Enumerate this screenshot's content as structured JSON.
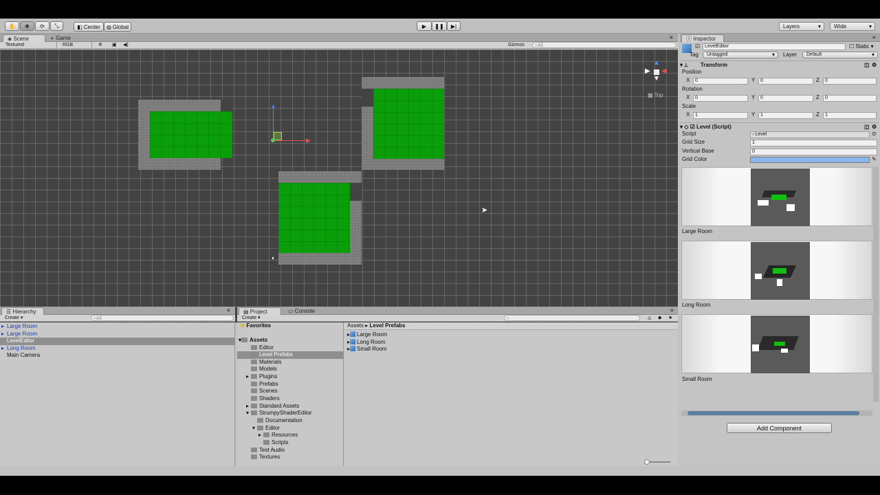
{
  "toolbar": {
    "pivot_label": "Center",
    "handle_label": "Global",
    "layers_label": "Layers",
    "layout_label": "Wide"
  },
  "scene": {
    "tabs": [
      "Scene",
      "Game"
    ],
    "draw_mode": "Textured",
    "color_mode": "RGB",
    "gizmos_label": "Gizmos",
    "search_placeholder": "All",
    "orientation_label": "Top"
  },
  "hierarchy": {
    "tab": "Hierarchy",
    "create_label": "Create",
    "search_placeholder": "All",
    "items": [
      {
        "label": "Large Room",
        "prefab": true,
        "expandable": true,
        "selected": false
      },
      {
        "label": "Large Room",
        "prefab": true,
        "expandable": true,
        "selected": false
      },
      {
        "label": "LevelEditor",
        "prefab": false,
        "expandable": false,
        "selected": true
      },
      {
        "label": "Long Room",
        "prefab": true,
        "expandable": true,
        "selected": false
      },
      {
        "label": "Main Camera",
        "prefab": false,
        "expandable": false,
        "selected": false
      }
    ]
  },
  "project": {
    "tabs": [
      "Project",
      "Console"
    ],
    "create_label": "Create",
    "favorites_label": "Favorites",
    "assets_label": "Assets",
    "tree": [
      {
        "label": "Editor",
        "depth": 1,
        "expandable": false,
        "selected": false
      },
      {
        "label": "Level Prefabs",
        "depth": 1,
        "expandable": false,
        "selected": true
      },
      {
        "label": "Materials",
        "depth": 1,
        "expandable": false,
        "selected": false
      },
      {
        "label": "Models",
        "depth": 1,
        "expandable": false,
        "selected": false
      },
      {
        "label": "Plugins",
        "depth": 1,
        "expandable": true,
        "selected": false
      },
      {
        "label": "Prefabs",
        "depth": 1,
        "expandable": false,
        "selected": false
      },
      {
        "label": "Scenes",
        "depth": 1,
        "expandable": false,
        "selected": false
      },
      {
        "label": "Shaders",
        "depth": 1,
        "expandable": false,
        "selected": false
      },
      {
        "label": "Standard Assets",
        "depth": 1,
        "expandable": true,
        "selected": false
      },
      {
        "label": "StrumpyShaderEditor",
        "depth": 1,
        "expandable": true,
        "selected": false
      },
      {
        "label": "Documentation",
        "depth": 2,
        "expandable": false,
        "selected": false
      },
      {
        "label": "Editor",
        "depth": 2,
        "expandable": true,
        "selected": false
      },
      {
        "label": "Resources",
        "depth": 3,
        "expandable": true,
        "selected": false
      },
      {
        "label": "Scripts",
        "depth": 3,
        "expandable": false,
        "selected": false
      },
      {
        "label": "Test Audio",
        "depth": 1,
        "expandable": false,
        "selected": false
      },
      {
        "label": "Textures",
        "depth": 1,
        "expandable": false,
        "selected": false
      }
    ],
    "breadcrumb_root": "Assets",
    "breadcrumb_current": "Level Prefabs",
    "files": [
      "Large Room",
      "Long Room",
      "Small Room"
    ]
  },
  "inspector": {
    "tab": "Inspector",
    "object_name": "LevelEditor",
    "static_label": "Static",
    "tag_label": "Tag",
    "tag_value": "Untagged",
    "layer_label": "Layer",
    "layer_value": "Default",
    "transform_title": "Transform",
    "position_label": "Position",
    "rotation_label": "Rotation",
    "scale_label": "Scale",
    "axis_x": "X",
    "axis_y": "Y",
    "axis_z": "Z",
    "position": [
      "0",
      "0",
      "0"
    ],
    "rotation": [
      "0",
      "0",
      "0"
    ],
    "scale": [
      "1",
      "1",
      "1"
    ],
    "script_title": "Level (Script)",
    "script_label": "Script",
    "script_value": "Level",
    "grid_size_label": "Grid Size",
    "grid_size_value": "1",
    "vertical_base_label": "Vertical Base",
    "vertical_base_value": "0",
    "grid_color_label": "Grid Color",
    "grid_color": "#8ab8ee",
    "previews": [
      "Large Room",
      "Long Room",
      "Small Room"
    ],
    "add_component_label": "Add Component"
  },
  "colors": {
    "floor": "#0a9e0a",
    "wall": "#7a7a7a",
    "scene_bg": "#434343",
    "prefab_text": "#1f3fa8"
  }
}
